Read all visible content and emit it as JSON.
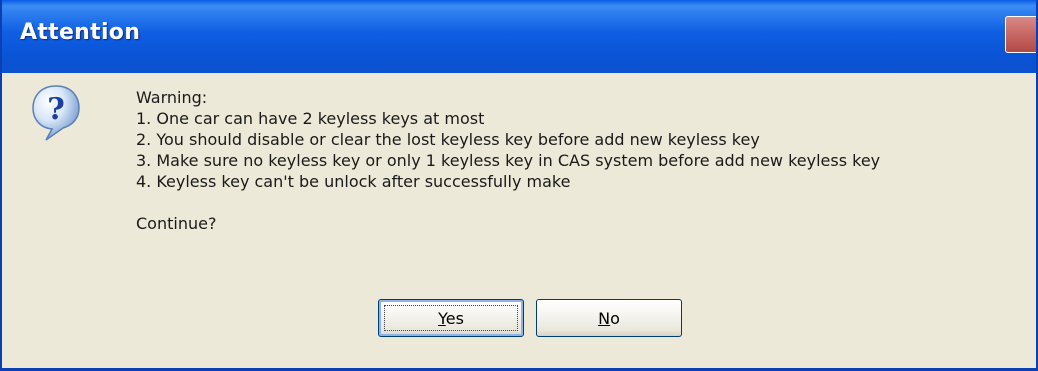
{
  "dialog": {
    "title": "Attention",
    "close_icon": "close-icon",
    "icon": "question-icon"
  },
  "message": {
    "heading": "Warning:",
    "lines": [
      "1. One car can have 2 keyless keys at most",
      "2. You should disable or clear the lost keyless key before add new keyless key",
      "3. Make sure no keyless key or only 1 keyless key in CAS system before add new keyless key",
      "4. Keyless key can't be unlock after successfully make"
    ],
    "prompt": "Continue?"
  },
  "buttons": {
    "yes": {
      "mnemonic": "Y",
      "rest": "es"
    },
    "no": {
      "mnemonic": "N",
      "rest": "o"
    }
  },
  "colors": {
    "titlebar": "#0a54d6",
    "face": "#ece9d8",
    "border": "#0a3fb5",
    "close": "#c96a66"
  }
}
